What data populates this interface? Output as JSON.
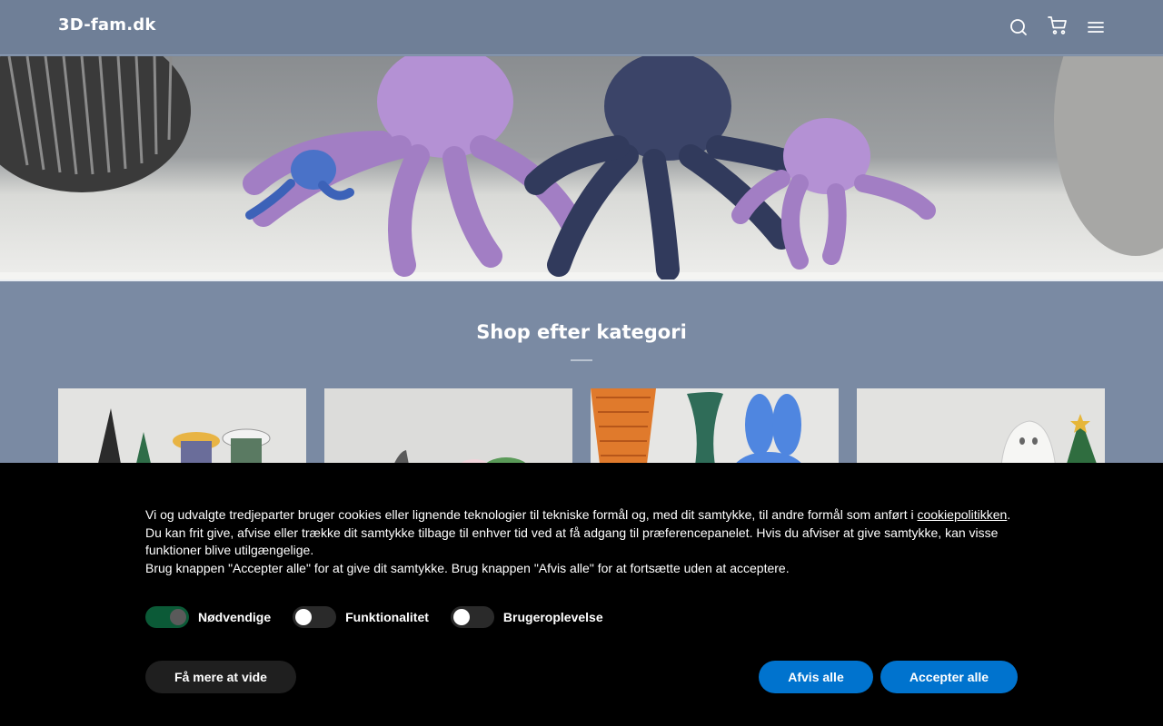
{
  "header": {
    "logo": "3D-fam.dk",
    "icons": [
      "search-icon",
      "cart-icon",
      "menu-icon"
    ]
  },
  "categories": {
    "title": "Shop efter kategori",
    "card_count_visible": 4
  },
  "cookie_banner": {
    "text_line1_before_link": "Vi og udvalgte tredjeparter bruger cookies eller lignende teknologier til tekniske formål og, med dit samtykke, til andre formål som anført i ",
    "link": "cookiepolitikken",
    "text_line1_after_link": ".",
    "text_line2": "Du kan frit give, afvise eller trække dit samtykke tilbage til enhver tid ved at få adgang til præferencepanelet. Hvis du afviser at give samtykke, kan visse funktioner blive utilgængelige.",
    "text_line3": "Brug knappen \"Accepter alle\" for at give dit samtykke. Brug knappen \"Afvis alle\" for at fortsætte uden at acceptere.",
    "toggles": [
      {
        "label": "Nødvendige",
        "on": true
      },
      {
        "label": "Funktionalitet",
        "on": false
      },
      {
        "label": "Brugeroplevelse",
        "on": false
      }
    ],
    "buttons": {
      "more": "Få mere at vide",
      "reject": "Afvis alle",
      "accept": "Accepter alle"
    }
  },
  "colors": {
    "page_bg": "#7a8aa3",
    "header_bg": "#6f7f97",
    "banner_bg": "#000000",
    "primary_button": "#0073ce",
    "toggle_on": "#0b5a37"
  }
}
